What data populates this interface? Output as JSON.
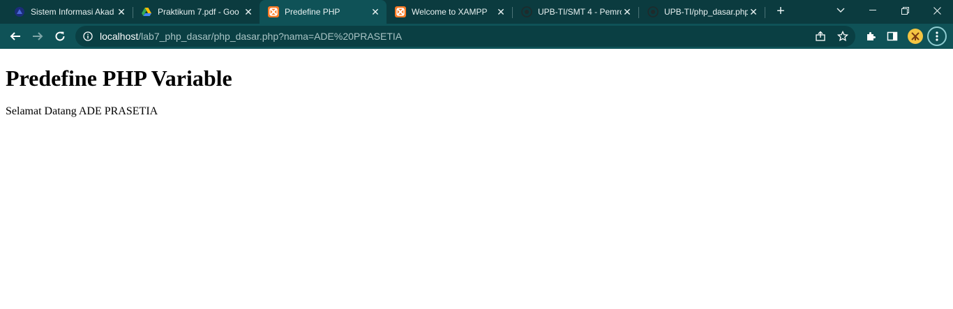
{
  "browser": {
    "tabs": [
      {
        "title": "Sistem Informasi Akad",
        "icon": "university-logo-icon",
        "active": false
      },
      {
        "title": "Praktikum 7.pdf - Goo",
        "icon": "google-drive-icon",
        "active": false
      },
      {
        "title": "Predefine PHP",
        "icon": "xampp-icon",
        "active": true
      },
      {
        "title": "Welcome to XAMPP",
        "icon": "xampp-icon",
        "active": false
      },
      {
        "title": "UPB-TI/SMT 4 - Pemro",
        "icon": "github-icon",
        "active": false
      },
      {
        "title": "UPB-TI/php_dasar.php",
        "icon": "github-icon",
        "active": false
      }
    ],
    "address": {
      "host": "localhost",
      "path": "/lab7_php_dasar/php_dasar.php?nama=ADE%20PRASETIA"
    },
    "colors": {
      "tabstrip": "#0b3b3f",
      "toolbar": "#0f5257",
      "accent_xampp": "#fb7a24"
    }
  },
  "page": {
    "heading": "Predefine PHP Variable",
    "greeting": "Selamat Datang ADE PRASETIA"
  }
}
